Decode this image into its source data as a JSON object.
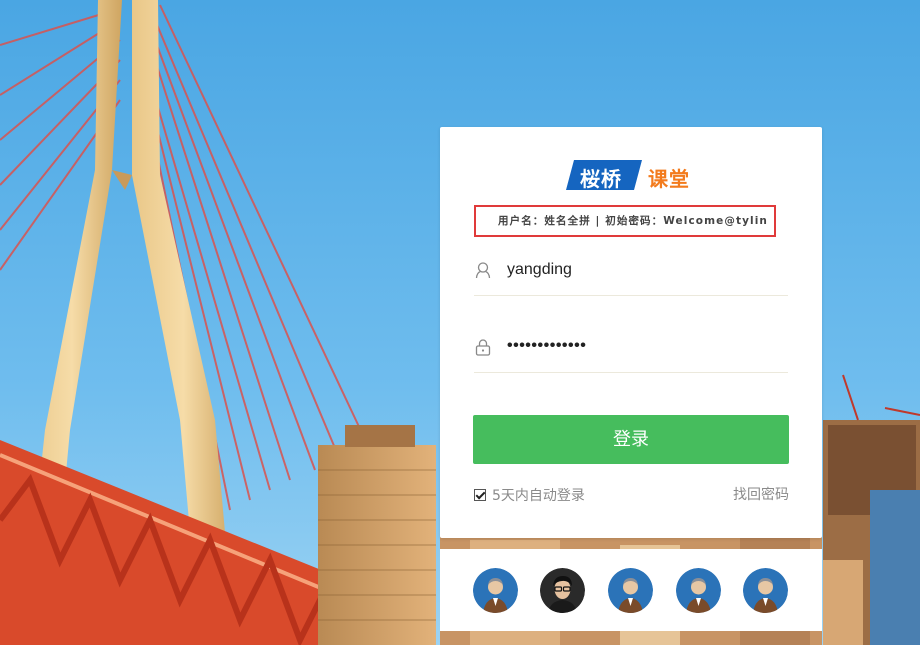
{
  "logo": {
    "part1": "桜桥",
    "part2": "课堂"
  },
  "hint_text": "用户名：姓名全拼 | 初始密码：Welcome@tylin",
  "username": {
    "value": "yangding",
    "icon": "user-icon"
  },
  "password": {
    "value": "•••••••••••••",
    "icon": "lock-icon"
  },
  "login_button": "登录",
  "remember_label": "5天内自动登录",
  "remember_checked": true,
  "forgot_password": "找回密码",
  "colors": {
    "accent_green": "#46bd5d",
    "brand_blue": "#1565c0",
    "brand_orange": "#f37b1d",
    "hint_border": "#e03a3a"
  },
  "avatars": [
    {
      "name": "default-avatar-1",
      "style": "default"
    },
    {
      "name": "photo-avatar",
      "style": "photo"
    },
    {
      "name": "default-avatar-2",
      "style": "default"
    },
    {
      "name": "default-avatar-3",
      "style": "default"
    },
    {
      "name": "default-avatar-4",
      "style": "default"
    }
  ]
}
